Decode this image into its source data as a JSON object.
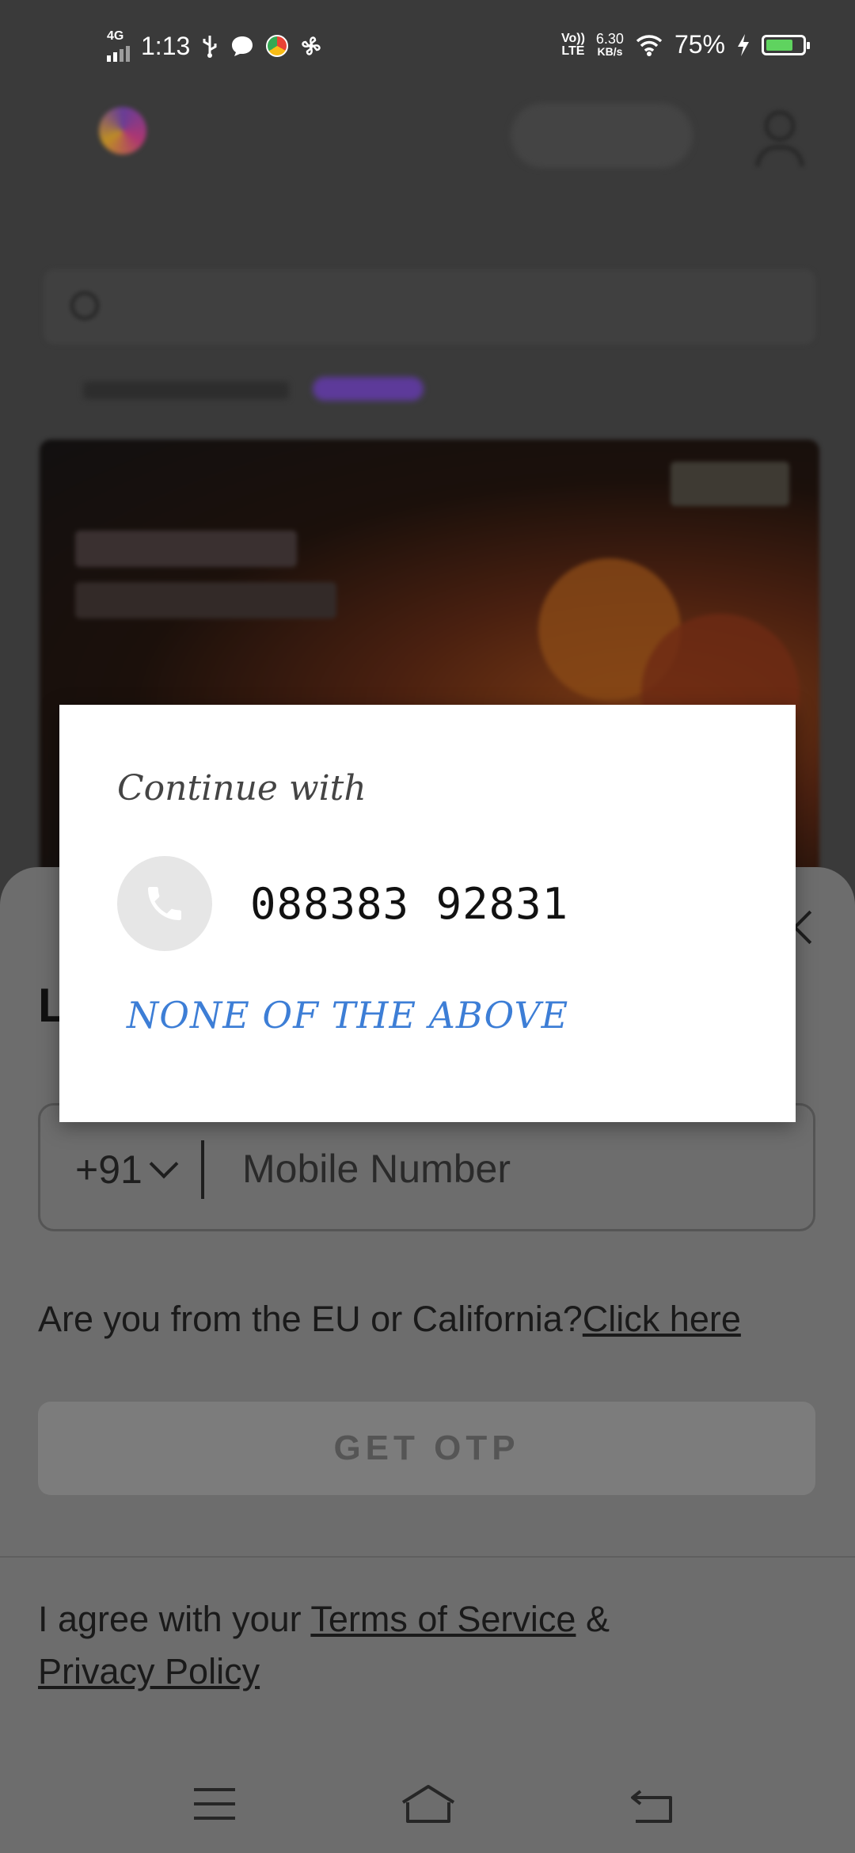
{
  "status_bar": {
    "network": "4G",
    "time": "1:13",
    "volte_line1": "Vo))",
    "volte_line2": "LTE",
    "speed_value": "6.30",
    "speed_unit": "KB/s",
    "battery": "75%",
    "battery_level": 0.75
  },
  "login_sheet": {
    "title": "L",
    "country_code": "+91",
    "mobile_placeholder": "Mobile Number",
    "eu_question": "Are you from the EU or California?",
    "eu_link": "Click here",
    "otp_button": "GET OTP",
    "agree_prefix": "I agree with your ",
    "terms_link": "Terms of Service",
    "agree_and": " & ",
    "privacy_link": "Privacy Policy"
  },
  "dialog": {
    "title": "Continue with",
    "account_number": "088383 92831",
    "account_icon": "phone-icon",
    "none_button": "NONE OF THE ABOVE"
  },
  "colors": {
    "dialog_action": "#3d7ed6",
    "scrim": "#3a3a3a",
    "sheet": "#6d6d6d"
  }
}
